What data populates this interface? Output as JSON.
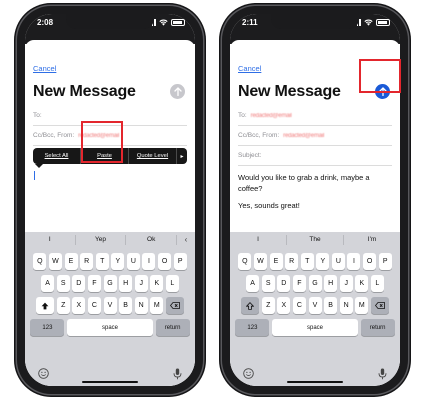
{
  "left": {
    "status_time": "2:08",
    "cancel": "Cancel",
    "title": "New Message",
    "to_label": "To:",
    "cc_label": "Cc/Bcc, From:",
    "from_value": "redacted@email",
    "edit_menu": {
      "select_all": "Select All",
      "paste": "Paste",
      "quote_level": "Quote Level",
      "more": "▸"
    },
    "predictive": [
      "I",
      "Yep",
      "Ok"
    ]
  },
  "right": {
    "status_time": "2:11",
    "cancel": "Cancel",
    "title": "New Message",
    "to_label": "To:",
    "to_value": "redacted@email",
    "cc_label": "Cc/Bcc, From:",
    "from_value": "redacted@email",
    "subject_label": "Subject:",
    "body_line1": "Would you like to grab a drink, maybe a coffee?",
    "body_line2": "Yes, sounds great!",
    "predictive": [
      "I",
      "The",
      "I'm"
    ]
  },
  "keyboard": {
    "row1": [
      "Q",
      "W",
      "E",
      "R",
      "T",
      "Y",
      "U",
      "I",
      "O",
      "P"
    ],
    "row2": [
      "A",
      "S",
      "D",
      "F",
      "G",
      "H",
      "J",
      "K",
      "L"
    ],
    "row3": [
      "Z",
      "X",
      "C",
      "V",
      "B",
      "N",
      "M"
    ],
    "numbers": "123",
    "space": "space",
    "return": "return"
  },
  "colors": {
    "highlight": "#e3262d",
    "send_active": "#1a5ad7",
    "link": "#2e6ee6"
  },
  "icons": [
    "signal-icon",
    "wifi-icon",
    "battery-icon",
    "send-arrow-icon",
    "shift-icon",
    "delete-icon",
    "emoji-icon",
    "mic-icon",
    "chevron-left-icon"
  ]
}
